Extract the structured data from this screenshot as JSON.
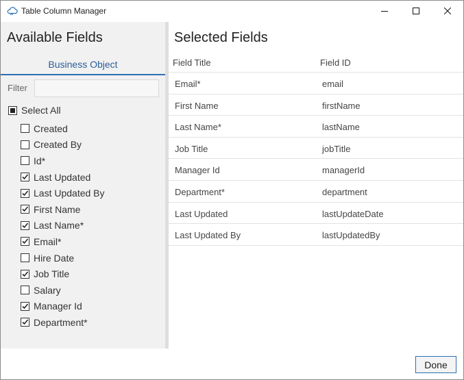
{
  "window": {
    "title": "Table Column Manager",
    "icon": "cloud-icon"
  },
  "left_panel": {
    "heading": "Available Fields",
    "tab_label": "Business Object",
    "filter_label": "Filter",
    "filter_value": "",
    "select_all": {
      "label": "Select All",
      "state": "partial"
    },
    "fields": [
      {
        "label": "Created",
        "checked": false
      },
      {
        "label": "Created By",
        "checked": false
      },
      {
        "label": "Id*",
        "checked": false
      },
      {
        "label": "Last Updated",
        "checked": true
      },
      {
        "label": "Last Updated By",
        "checked": true
      },
      {
        "label": "First Name",
        "checked": true
      },
      {
        "label": "Last Name*",
        "checked": true
      },
      {
        "label": "Email*",
        "checked": true
      },
      {
        "label": "Hire Date",
        "checked": false
      },
      {
        "label": "Job Title",
        "checked": true
      },
      {
        "label": "Salary",
        "checked": false
      },
      {
        "label": "Manager Id",
        "checked": true
      },
      {
        "label": "Department*",
        "checked": true
      }
    ]
  },
  "right_panel": {
    "heading": "Selected Fields",
    "columns": [
      "Field Title",
      "Field ID"
    ],
    "rows": [
      {
        "title": "Email*",
        "id": "email"
      },
      {
        "title": "First Name",
        "id": "firstName"
      },
      {
        "title": "Last Name*",
        "id": "lastName"
      },
      {
        "title": "Job Title",
        "id": "jobTitle"
      },
      {
        "title": "Manager Id",
        "id": "managerId"
      },
      {
        "title": "Department*",
        "id": "department"
      },
      {
        "title": "Last Updated",
        "id": "lastUpdateDate"
      },
      {
        "title": "Last Updated By",
        "id": "lastUpdatedBy"
      }
    ]
  },
  "footer": {
    "done_label": "Done"
  },
  "colors": {
    "accent": "#2a6fb3",
    "tab_text": "#2a5d9a",
    "panel_bg": "#f1f1f1"
  }
}
